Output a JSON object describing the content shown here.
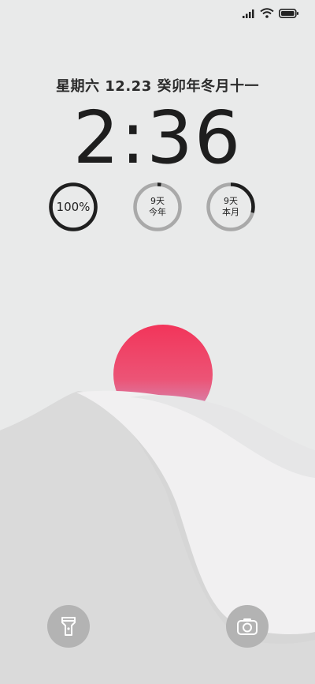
{
  "status_bar": {
    "icons": [
      "signal-icon",
      "wifi-icon",
      "battery-icon"
    ]
  },
  "lock_screen": {
    "date_line": "星期六 12.23 癸卯年冬月十一",
    "time": "2:36"
  },
  "widgets": [
    {
      "name": "battery",
      "lines": [
        "100%"
      ],
      "progress": 1.0
    },
    {
      "name": "year-progress",
      "lines": [
        "9天",
        "今年"
      ],
      "progress": 0.025
    },
    {
      "name": "month-progress",
      "lines": [
        "9天",
        "本月"
      ],
      "progress": 0.29
    }
  ],
  "shortcuts": {
    "left": {
      "icon": "flashlight-icon"
    },
    "right": {
      "icon": "camera-icon"
    }
  },
  "colors": {
    "background": "#e9eaea",
    "sun_top": "#f2355a",
    "sun_bottom": "#c9a4cf",
    "ring_active": "#1f1f1f",
    "ring_track": "#a9a9a9"
  }
}
